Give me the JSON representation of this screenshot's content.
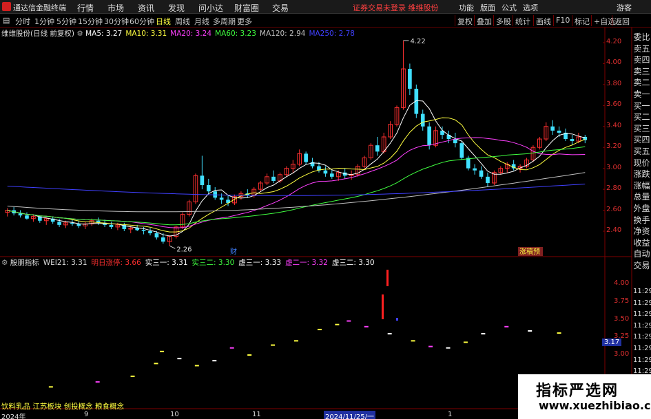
{
  "app": {
    "name": "通达信金融终端"
  },
  "menu": [
    "行情",
    "市场",
    "资讯",
    "发现",
    "问小达",
    "财富圈",
    "交易"
  ],
  "notice": "证券交易未登录  维维股份",
  "right_menu": [
    "功能",
    "版面",
    "公式",
    "选项",
    "游客"
  ],
  "periods": [
    "分时",
    "1分钟",
    "5分钟",
    "15分钟",
    "30分钟",
    "60分钟",
    "日线",
    "周线",
    "月线",
    "多周期",
    "更多"
  ],
  "active_period": "日线",
  "tools": [
    "复权",
    "叠加",
    "多股",
    "统计",
    "画线",
    "F10",
    "标记",
    "+自选",
    "返回"
  ],
  "main_info": {
    "stock": "维维股份(日线 前复权)",
    "ma": [
      {
        "label": "MA5: 3.27",
        "color": "#ffffff"
      },
      {
        "label": "MA10: 3.31",
        "color": "#ffff40"
      },
      {
        "label": "MA20: 3.24",
        "color": "#ff40ff"
      },
      {
        "label": "MA60: 3.23",
        "color": "#40ff40"
      },
      {
        "label": "MA120: 2.94",
        "color": "#c0c0c0"
      },
      {
        "label": "MA250: 2.78",
        "color": "#4040ff"
      }
    ]
  },
  "indicator_info": {
    "name": "殷朋指标",
    "items": [
      {
        "label": "WEI21: 3.31",
        "color": "#dddddd"
      },
      {
        "label": "明日涨停: 3.66",
        "color": "#ff3030"
      },
      {
        "label": "实三一: 3.31",
        "color": "#ffffff"
      },
      {
        "label": "实三二: 3.30",
        "color": "#40ff40"
      },
      {
        "label": "虚三一: 3.33",
        "color": "#ffffff"
      },
      {
        "label": "虚二一: 3.32",
        "color": "#ff40ff"
      },
      {
        "label": "虚三二: 3.30",
        "color": "#ffffff"
      }
    ]
  },
  "price_axis": [
    "4.20",
    "4.00",
    "3.80",
    "3.60",
    "3.40",
    "3.20",
    "3.00",
    "2.80",
    "2.60",
    "2.40"
  ],
  "ind_axis": [
    "4.00",
    "3.75",
    "3.50",
    "3.25",
    "3.00"
  ],
  "ind_axis_marker": "3.17",
  "annotations": {
    "high": "4.22",
    "low": "2.26",
    "cai": "财",
    "badge": "涨稿预"
  },
  "right_side": [
    "委比",
    "卖五",
    "卖四",
    "卖三",
    "卖二",
    "卖一",
    "买一",
    "买二",
    "买三",
    "买四",
    "买五",
    "现价",
    "涨跌",
    "涨幅",
    "总量",
    "外盘",
    "换手",
    "净资",
    "收益",
    "自动",
    "交易"
  ],
  "times": [
    "11:29",
    "11:29",
    "11:29",
    "11:29",
    "11:29",
    "11:29",
    "11:29",
    "11:29",
    "11:29",
    "11:29",
    "11:29"
  ],
  "concepts": "饮料乳品  江苏板块  创投概念  粮食概念",
  "dates": {
    "y2024": "2024年",
    "m9": "9",
    "m10": "10",
    "m11": "11",
    "cursor": "2024/11/25/一",
    "m1": "1"
  },
  "watermark": {
    "line1": "指标严选网",
    "line2": "www.xuezhibiao.com"
  },
  "colors": {
    "up": "#ff3030",
    "down": "#40e0ff",
    "axis": "#e03030",
    "frame": "#800000"
  },
  "chart_data": {
    "type": "candlestick",
    "ylim": [
      2.26,
      4.22
    ],
    "price_high": 4.22,
    "price_low": 2.26,
    "candles": [
      [
        2.58,
        2.62,
        2.54,
        2.6
      ],
      [
        2.6,
        2.63,
        2.55,
        2.57
      ],
      [
        2.57,
        2.6,
        2.53,
        2.55
      ],
      [
        2.55,
        2.58,
        2.51,
        2.52
      ],
      [
        2.52,
        2.56,
        2.49,
        2.54
      ],
      [
        2.54,
        2.55,
        2.48,
        2.5
      ],
      [
        2.5,
        2.53,
        2.46,
        2.52
      ],
      [
        2.52,
        2.54,
        2.47,
        2.49
      ],
      [
        2.49,
        2.52,
        2.44,
        2.46
      ],
      [
        2.46,
        2.5,
        2.43,
        2.48
      ],
      [
        2.48,
        2.51,
        2.45,
        2.47
      ],
      [
        2.47,
        2.5,
        2.43,
        2.45
      ],
      [
        2.45,
        2.49,
        2.42,
        2.47
      ],
      [
        2.47,
        2.52,
        2.45,
        2.5
      ],
      [
        2.5,
        2.53,
        2.46,
        2.48
      ],
      [
        2.48,
        2.51,
        2.44,
        2.46
      ],
      [
        2.46,
        2.49,
        2.42,
        2.44
      ],
      [
        2.44,
        2.48,
        2.41,
        2.46
      ],
      [
        2.46,
        2.48,
        2.4,
        2.42
      ],
      [
        2.42,
        2.45,
        2.38,
        2.43
      ],
      [
        2.43,
        2.46,
        2.4,
        2.41
      ],
      [
        2.41,
        2.44,
        2.37,
        2.4
      ],
      [
        2.4,
        2.43,
        2.36,
        2.38
      ],
      [
        2.38,
        2.4,
        2.32,
        2.34
      ],
      [
        2.34,
        2.38,
        2.28,
        2.3
      ],
      [
        2.3,
        2.36,
        2.26,
        2.35
      ],
      [
        2.35,
        2.45,
        2.33,
        2.44
      ],
      [
        2.44,
        2.58,
        2.42,
        2.56
      ],
      [
        2.56,
        2.7,
        2.54,
        2.68
      ],
      [
        2.68,
        2.95,
        2.66,
        2.93
      ],
      [
        2.93,
        3.12,
        2.8,
        2.84
      ],
      [
        2.84,
        2.9,
        2.76,
        2.78
      ],
      [
        2.78,
        2.82,
        2.7,
        2.72
      ],
      [
        2.72,
        2.76,
        2.66,
        2.7
      ],
      [
        2.7,
        2.74,
        2.64,
        2.67
      ],
      [
        2.67,
        2.75,
        2.65,
        2.73
      ],
      [
        2.73,
        2.78,
        2.7,
        2.76
      ],
      [
        2.76,
        2.8,
        2.72,
        2.74
      ],
      [
        2.74,
        2.82,
        2.72,
        2.8
      ],
      [
        2.8,
        2.88,
        2.78,
        2.86
      ],
      [
        2.86,
        2.95,
        2.84,
        2.92
      ],
      [
        2.92,
        2.98,
        2.86,
        2.88
      ],
      [
        2.88,
        2.96,
        2.86,
        2.94
      ],
      [
        2.94,
        3.02,
        2.92,
        3.0
      ],
      [
        3.0,
        3.08,
        2.96,
        3.04
      ],
      [
        3.04,
        3.18,
        3.02,
        3.14
      ],
      [
        3.14,
        3.16,
        3.04,
        3.06
      ],
      [
        3.06,
        3.1,
        3.0,
        3.02
      ],
      [
        3.02,
        3.06,
        2.96,
        2.98
      ],
      [
        2.98,
        3.02,
        2.92,
        2.95
      ],
      [
        2.95,
        2.99,
        2.9,
        2.92
      ],
      [
        2.92,
        2.98,
        2.88,
        2.96
      ],
      [
        2.96,
        3.0,
        2.9,
        2.93
      ],
      [
        2.93,
        2.98,
        2.89,
        2.94
      ],
      [
        2.94,
        3.04,
        2.92,
        3.02
      ],
      [
        3.02,
        3.12,
        3.0,
        3.1
      ],
      [
        3.1,
        3.24,
        3.08,
        3.22
      ],
      [
        3.22,
        3.3,
        3.12,
        3.16
      ],
      [
        3.16,
        3.34,
        3.14,
        3.3
      ],
      [
        3.3,
        3.45,
        3.28,
        3.42
      ],
      [
        3.42,
        3.6,
        3.4,
        3.58
      ],
      [
        3.58,
        4.22,
        3.56,
        3.95
      ],
      [
        3.95,
        4.0,
        3.7,
        3.76
      ],
      [
        3.76,
        3.8,
        3.48,
        3.52
      ],
      [
        3.52,
        3.56,
        3.36,
        3.4
      ],
      [
        3.4,
        3.44,
        3.18,
        3.22
      ],
      [
        3.22,
        3.4,
        3.2,
        3.36
      ],
      [
        3.36,
        3.4,
        3.28,
        3.32
      ],
      [
        3.32,
        3.36,
        3.24,
        3.28
      ],
      [
        3.28,
        3.34,
        3.2,
        3.24
      ],
      [
        3.24,
        3.26,
        3.08,
        3.1
      ],
      [
        3.1,
        3.12,
        2.98,
        3.0
      ],
      [
        3.0,
        3.04,
        2.94,
        2.98
      ],
      [
        2.98,
        3.02,
        2.9,
        2.92
      ],
      [
        2.92,
        2.96,
        2.82,
        2.86
      ],
      [
        2.86,
        2.98,
        2.84,
        2.96
      ],
      [
        2.96,
        3.02,
        2.94,
        3.0
      ],
      [
        3.0,
        3.06,
        2.96,
        3.04
      ],
      [
        3.04,
        3.08,
        2.98,
        3.0
      ],
      [
        3.0,
        3.04,
        2.96,
        3.02
      ],
      [
        3.02,
        3.1,
        3.0,
        3.08
      ],
      [
        3.08,
        3.22,
        3.06,
        3.2
      ],
      [
        3.2,
        3.3,
        3.18,
        3.28
      ],
      [
        3.28,
        3.44,
        3.26,
        3.4
      ],
      [
        3.4,
        3.46,
        3.32,
        3.36
      ],
      [
        3.36,
        3.4,
        3.3,
        3.34
      ],
      [
        3.34,
        3.38,
        3.26,
        3.28
      ],
      [
        3.28,
        3.32,
        3.22,
        3.26
      ],
      [
        3.26,
        3.34,
        3.24,
        3.3
      ],
      [
        3.3,
        3.32,
        3.24,
        3.27
      ]
    ]
  },
  "indicator_marks": [
    {
      "x": 0.08,
      "y": 2.55,
      "c": "#ffff40"
    },
    {
      "x": 0.16,
      "y": 2.62,
      "c": "#ff40ff"
    },
    {
      "x": 0.22,
      "y": 2.7,
      "c": "#ffff40"
    },
    {
      "x": 0.26,
      "y": 2.88,
      "c": "#ffff40"
    },
    {
      "x": 0.27,
      "y": 3.05,
      "c": "#ffff40"
    },
    {
      "x": 0.3,
      "y": 2.95,
      "c": "#ffffff"
    },
    {
      "x": 0.33,
      "y": 2.85,
      "c": "#ffff40"
    },
    {
      "x": 0.36,
      "y": 2.92,
      "c": "#ffffff"
    },
    {
      "x": 0.39,
      "y": 3.1,
      "c": "#ff40ff"
    },
    {
      "x": 0.42,
      "y": 3.0,
      "c": "#ffff40"
    },
    {
      "x": 0.46,
      "y": 3.14,
      "c": "#ffff40"
    },
    {
      "x": 0.5,
      "y": 3.2,
      "c": "#ffff40"
    },
    {
      "x": 0.54,
      "y": 3.36,
      "c": "#ffff40"
    },
    {
      "x": 0.57,
      "y": 3.43,
      "c": "#ffff40"
    },
    {
      "x": 0.59,
      "y": 3.48,
      "c": "#ff40ff"
    },
    {
      "x": 0.62,
      "y": 3.4,
      "c": "#ff40ff"
    },
    {
      "x": 0.66,
      "y": 3.3,
      "c": "#ffffff"
    },
    {
      "x": 0.7,
      "y": 3.2,
      "c": "#ffff40"
    },
    {
      "x": 0.73,
      "y": 3.12,
      "c": "#ff40ff"
    },
    {
      "x": 0.76,
      "y": 3.1,
      "c": "#ffffff"
    },
    {
      "x": 0.79,
      "y": 3.18,
      "c": "#ffff40"
    },
    {
      "x": 0.82,
      "y": 3.3,
      "c": "#ffffff"
    },
    {
      "x": 0.86,
      "y": 3.4,
      "c": "#ff40ff"
    },
    {
      "x": 0.9,
      "y": 3.34,
      "c": "#ffffff"
    },
    {
      "x": 0.95,
      "y": 3.31,
      "c": "#ffff40"
    }
  ]
}
